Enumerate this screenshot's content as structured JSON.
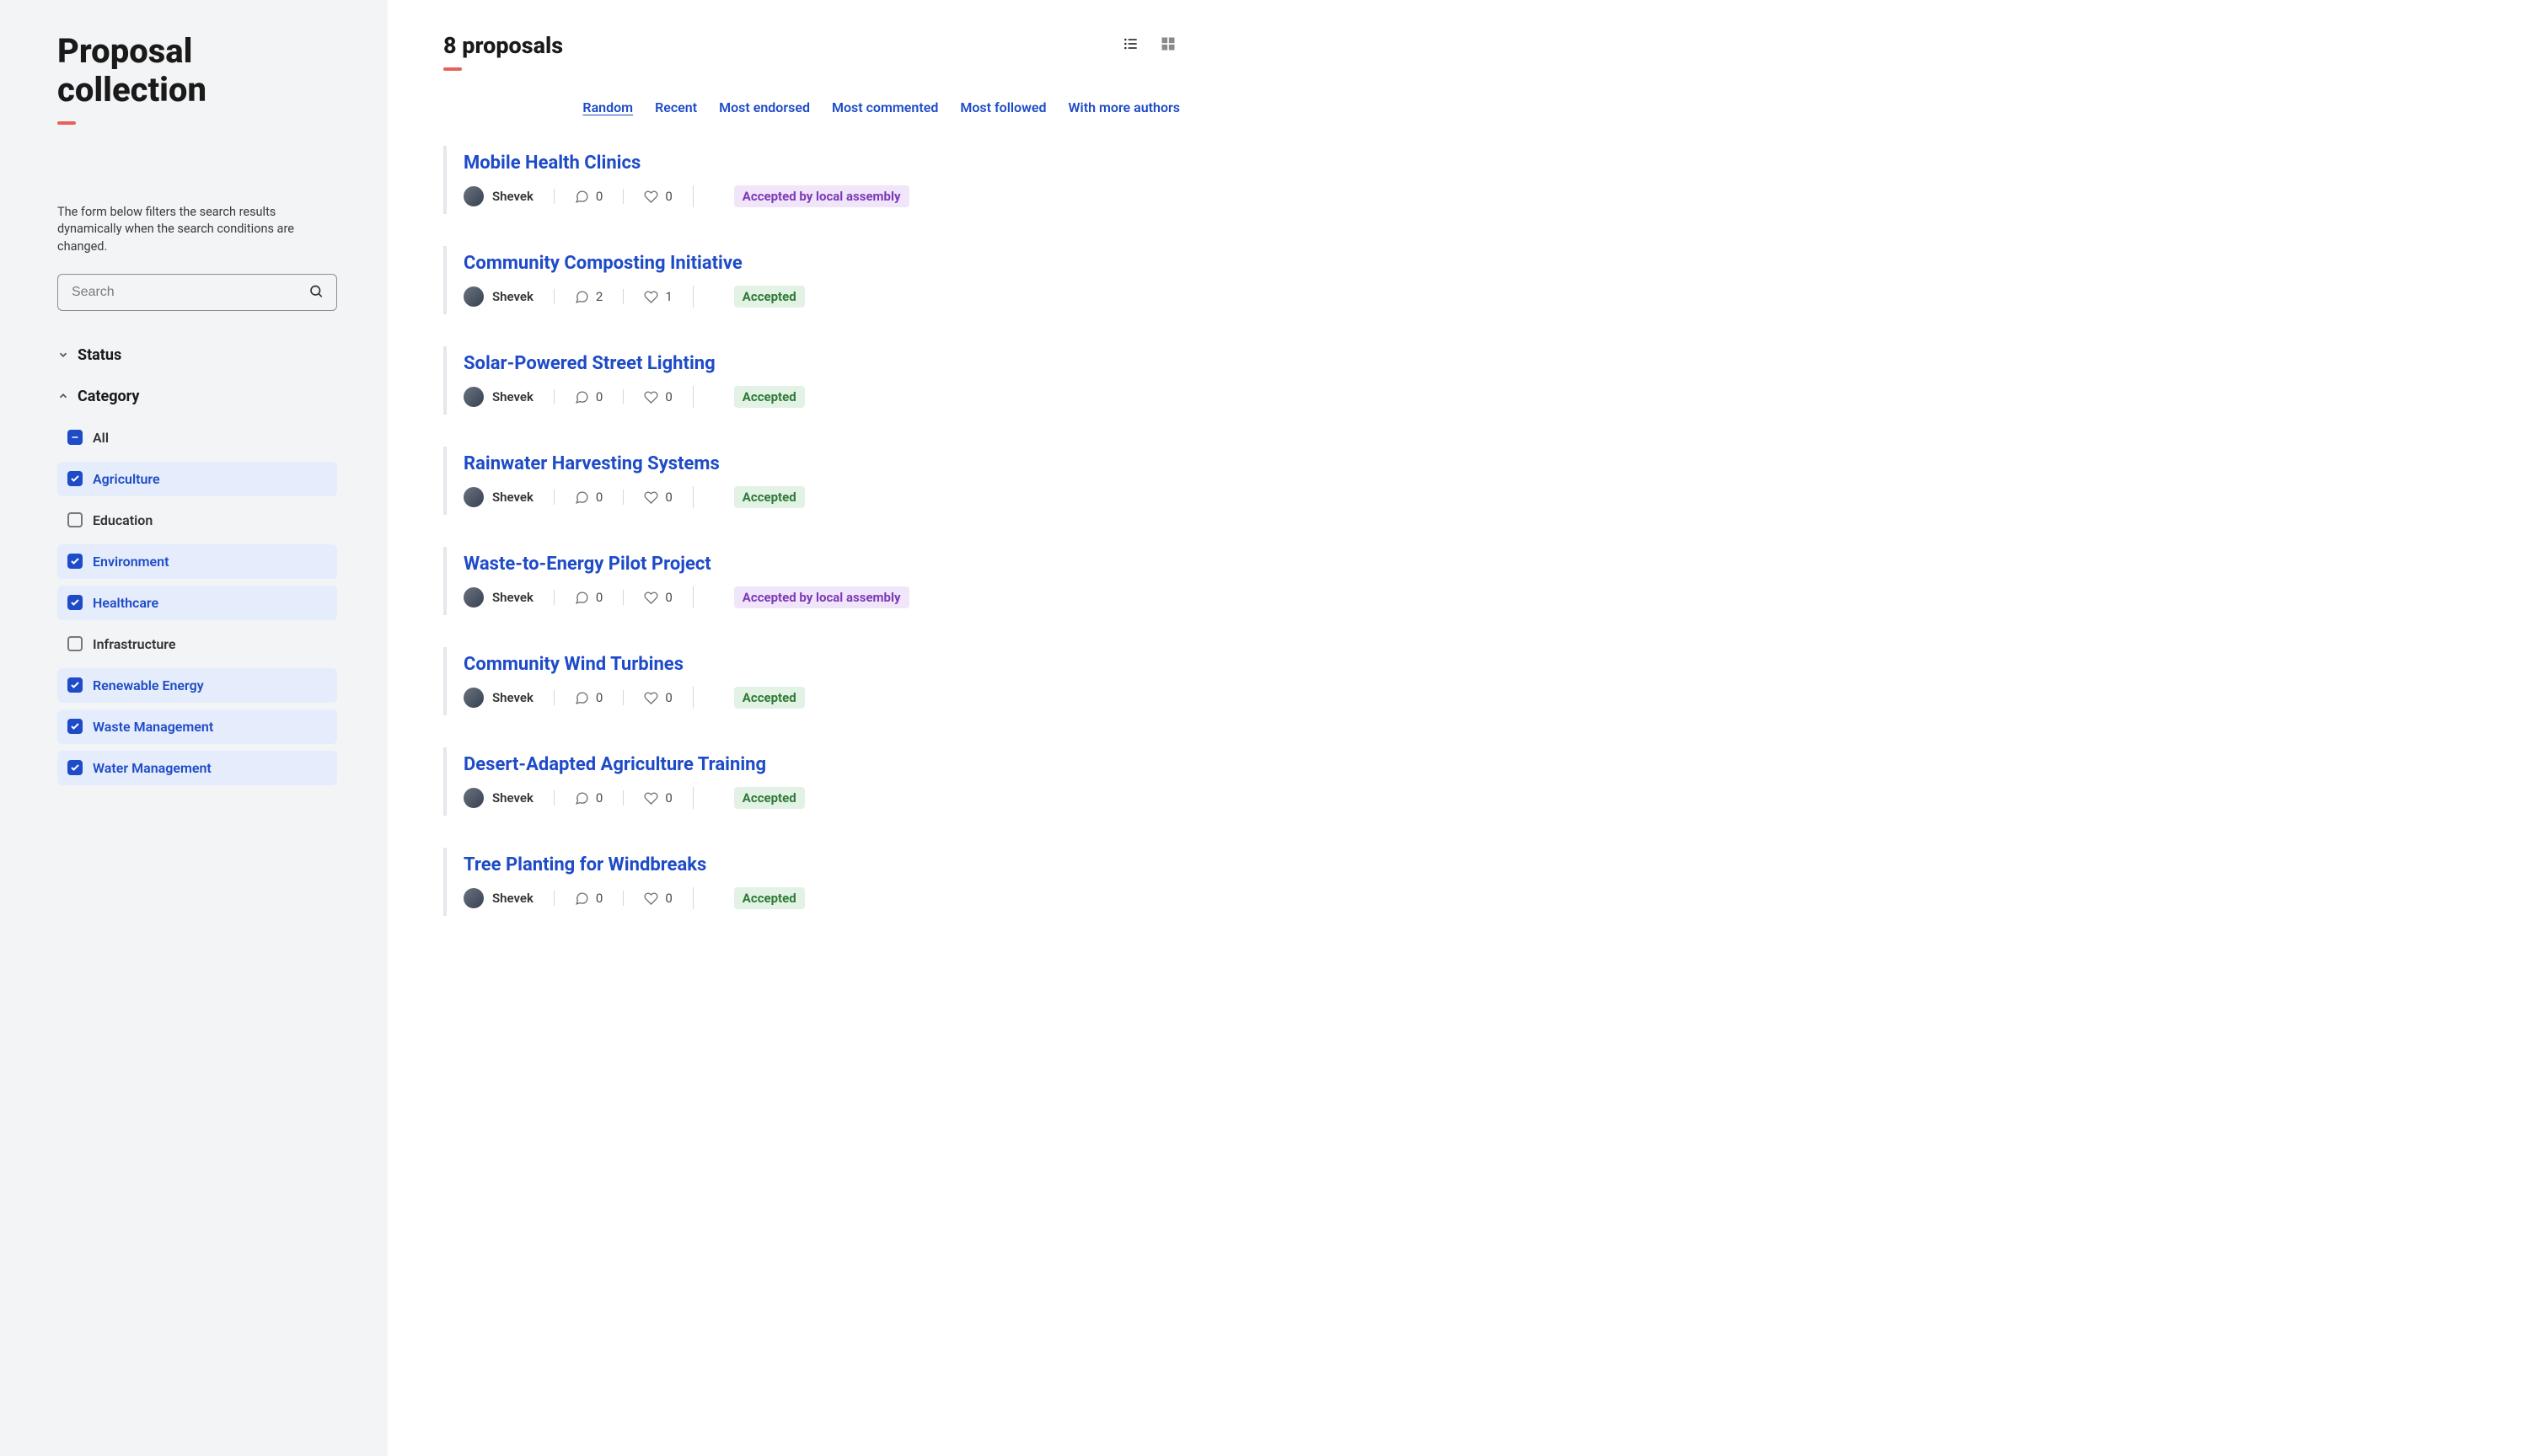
{
  "sidebar": {
    "title": "Proposal collection",
    "filter_hint": "The form below filters the search results dynamically when the search conditions are changed.",
    "search_placeholder": "Search",
    "status_label": "Status",
    "category_label": "Category",
    "categories": [
      {
        "label": "All",
        "state": "indeterminate"
      },
      {
        "label": "Agriculture",
        "state": "checked"
      },
      {
        "label": "Education",
        "state": "unchecked"
      },
      {
        "label": "Environment",
        "state": "checked"
      },
      {
        "label": "Healthcare",
        "state": "checked"
      },
      {
        "label": "Infrastructure",
        "state": "unchecked"
      },
      {
        "label": "Renewable Energy",
        "state": "checked"
      },
      {
        "label": "Waste Management",
        "state": "checked"
      },
      {
        "label": "Water Management",
        "state": "checked"
      }
    ]
  },
  "main": {
    "count_text": "8 proposals",
    "sort_tabs": [
      {
        "label": "Random",
        "active": true
      },
      {
        "label": "Recent",
        "active": false
      },
      {
        "label": "Most endorsed",
        "active": false
      },
      {
        "label": "Most commented",
        "active": false
      },
      {
        "label": "Most followed",
        "active": false
      },
      {
        "label": "With more authors",
        "active": false
      }
    ],
    "proposals": [
      {
        "title": "Mobile Health Clinics",
        "author": "Shevek",
        "comments": 0,
        "likes": 0,
        "status": "Accepted by local assembly",
        "status_style": "purple"
      },
      {
        "title": "Community Composting Initiative",
        "author": "Shevek",
        "comments": 2,
        "likes": 1,
        "status": "Accepted",
        "status_style": "green"
      },
      {
        "title": "Solar-Powered Street Lighting",
        "author": "Shevek",
        "comments": 0,
        "likes": 0,
        "status": "Accepted",
        "status_style": "green"
      },
      {
        "title": "Rainwater Harvesting Systems",
        "author": "Shevek",
        "comments": 0,
        "likes": 0,
        "status": "Accepted",
        "status_style": "green"
      },
      {
        "title": "Waste-to-Energy Pilot Project",
        "author": "Shevek",
        "comments": 0,
        "likes": 0,
        "status": "Accepted by local assembly",
        "status_style": "purple"
      },
      {
        "title": "Community Wind Turbines",
        "author": "Shevek",
        "comments": 0,
        "likes": 0,
        "status": "Accepted",
        "status_style": "green"
      },
      {
        "title": "Desert-Adapted Agriculture Training",
        "author": "Shevek",
        "comments": 0,
        "likes": 0,
        "status": "Accepted",
        "status_style": "green"
      },
      {
        "title": "Tree Planting for Windbreaks",
        "author": "Shevek",
        "comments": 0,
        "likes": 0,
        "status": "Accepted",
        "status_style": "green"
      }
    ]
  }
}
